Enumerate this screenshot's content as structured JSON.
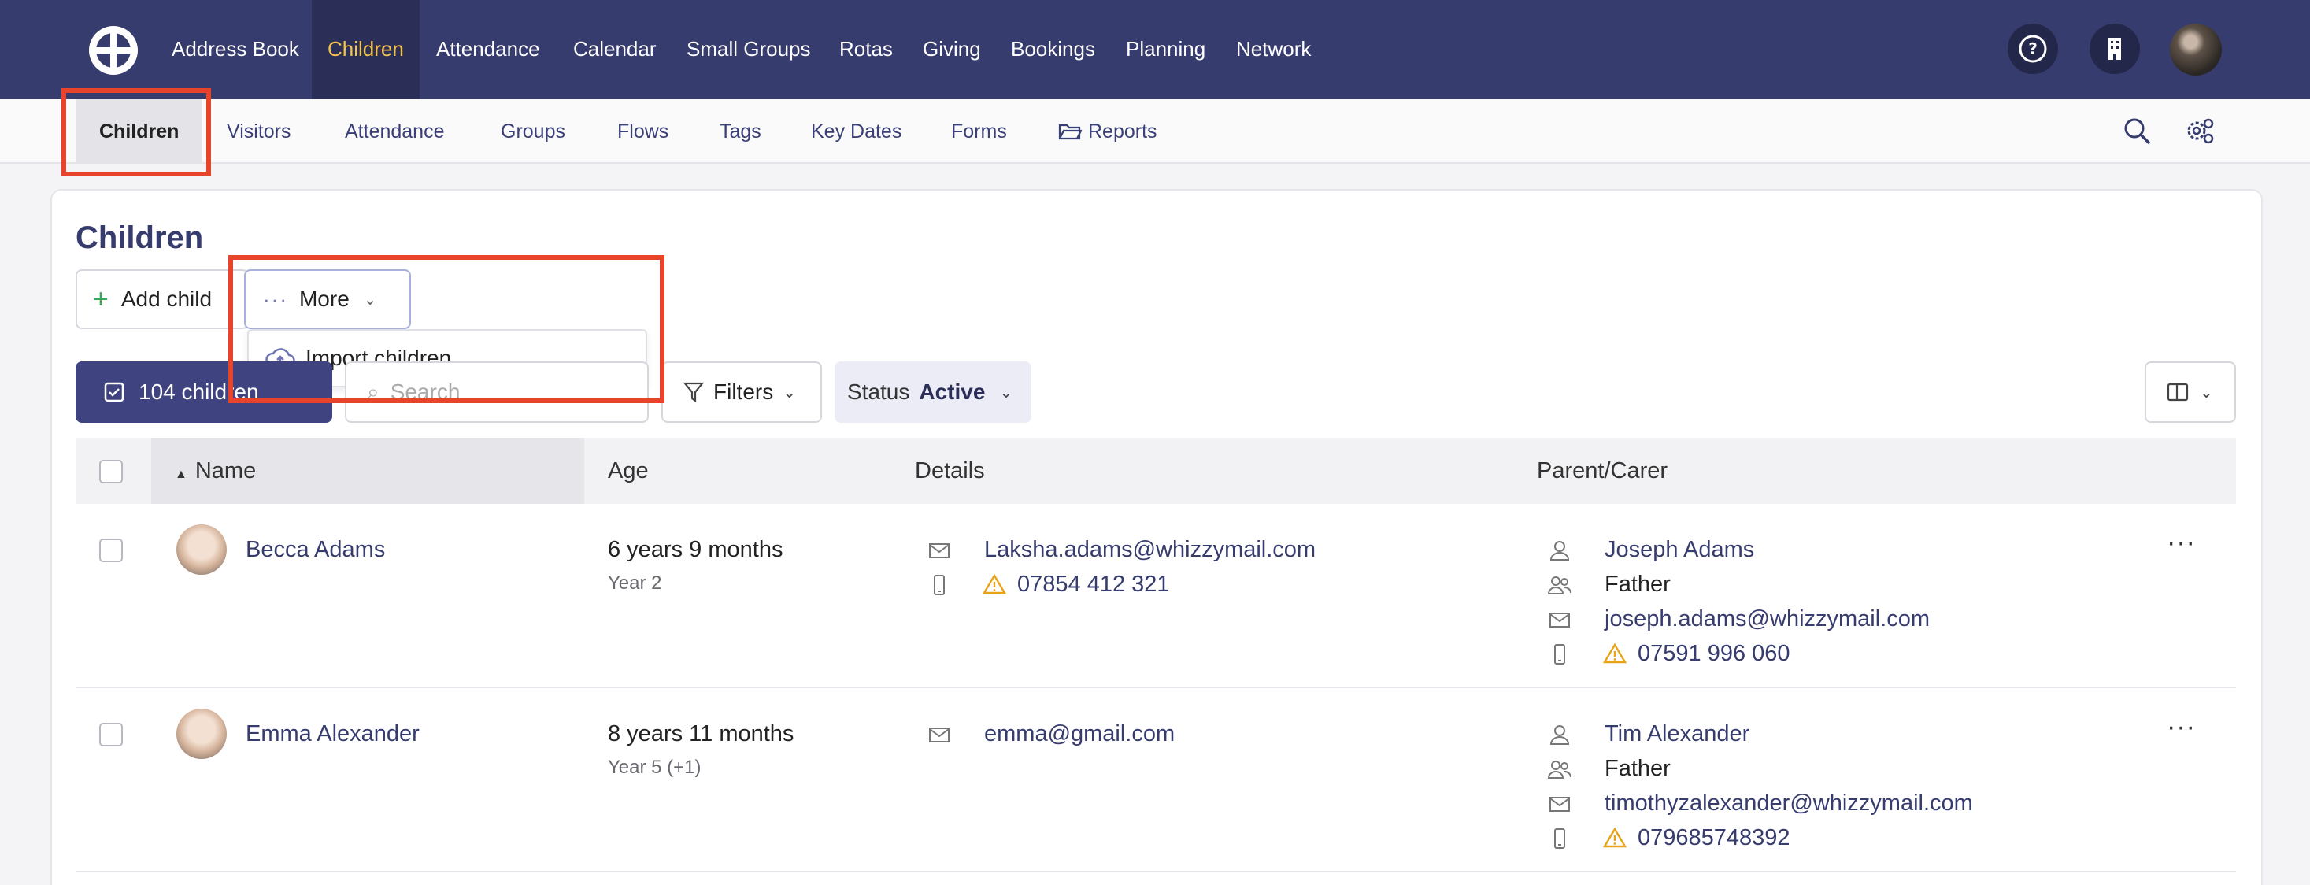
{
  "topnav": {
    "items": [
      "Address Book",
      "Children",
      "Attendance",
      "Calendar",
      "Small Groups",
      "Rotas",
      "Giving",
      "Bookings",
      "Planning",
      "Network"
    ],
    "active": "Children",
    "active_color": "#f4c14a",
    "bg_color": "#373c6e",
    "icons": [
      "help-icon",
      "building-icon",
      "user-avatar"
    ]
  },
  "subnav": {
    "items": [
      "Children",
      "Visitors",
      "Attendance",
      "Groups",
      "Flows",
      "Tags",
      "Key Dates",
      "Forms",
      "Reports"
    ],
    "active": "Children",
    "icons": [
      "folder-icon",
      "search-icon",
      "settings-icon"
    ]
  },
  "page": {
    "title": "Children",
    "add_child_label": "Add child",
    "more_label": "More",
    "dropdown_item": "Import children",
    "count_label": "104 children",
    "search_placeholder": "Search",
    "filters_label": "Filters",
    "status_label": "Status",
    "status_value": "Active",
    "highlight_color": "#e8432b"
  },
  "table": {
    "headers": [
      "Name",
      "Age",
      "Details",
      "Parent/Carer"
    ],
    "rows": [
      {
        "name": "Becca Adams",
        "age": "6 years 9 months",
        "year": "Year 2",
        "email": "Laksha.adams@whizzymail.com",
        "phone": "07854 412 321",
        "parent_name": "Joseph Adams",
        "relation": "Father",
        "parent_email": "joseph.adams@whizzymail.com",
        "parent_phone": "07591 996 060"
      },
      {
        "name": "Emma Alexander",
        "age": "8 years 11 months",
        "year": "Year 5 (+1)",
        "email": "emma@gmail.com",
        "phone": "",
        "parent_name": "Tim Alexander",
        "relation": "Father",
        "parent_email": "timothyzalexander@whizzymail.com",
        "parent_phone": "079685748392"
      }
    ]
  }
}
